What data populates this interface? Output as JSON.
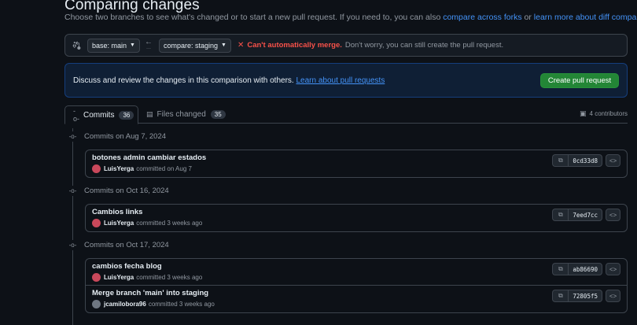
{
  "header": {
    "title": "Comparing changes",
    "subtitle_prefix": "Choose two branches to see what's changed or to start a new pull request. If you need to, you can also ",
    "subtitle_link1": "compare across forks",
    "subtitle_or": " or ",
    "subtitle_link2": "learn more about diff comparisons",
    "subtitle_suffix": "."
  },
  "range": {
    "base": "base: main",
    "compare": "compare: staging",
    "merge_status": "Can't automatically merge.",
    "merge_note": "Don't worry, you can still create the pull request."
  },
  "banner": {
    "text": "Discuss and review the changes in this comparison with others. ",
    "link": "Learn about pull requests",
    "button": "Create pull request"
  },
  "tabs": {
    "commits_label": "Commits",
    "commits_count": "36",
    "files_label": "Files changed",
    "files_count": "35",
    "contributors": "4 contributors"
  },
  "groups": [
    {
      "heading": "Commits on Aug 7, 2024",
      "commits": [
        {
          "message": "botones admin cambiar estados",
          "author": "LuisYerga",
          "when": "committed on Aug 7",
          "sha": "0cd33d8"
        }
      ]
    },
    {
      "heading": "Commits on Oct 16, 2024",
      "commits": [
        {
          "message": "Cambios links",
          "author": "LuisYerga",
          "when": "committed 3 weeks ago",
          "sha": "7eed7cc"
        }
      ]
    },
    {
      "heading": "Commits on Oct 17, 2024",
      "commits": [
        {
          "message": "cambios fecha blog",
          "author": "LuisYerga",
          "when": "committed 3 weeks ago",
          "sha": "ab86690"
        },
        {
          "message": "Merge branch 'main' into staging",
          "author": "jcamilobora96",
          "when": "committed 3 weeks ago",
          "sha": "72805f5"
        }
      ]
    }
  ],
  "colors": {
    "background": "#0d1117",
    "accent_link": "#4493f8",
    "danger": "#f85149",
    "primary_button": "#238636"
  }
}
